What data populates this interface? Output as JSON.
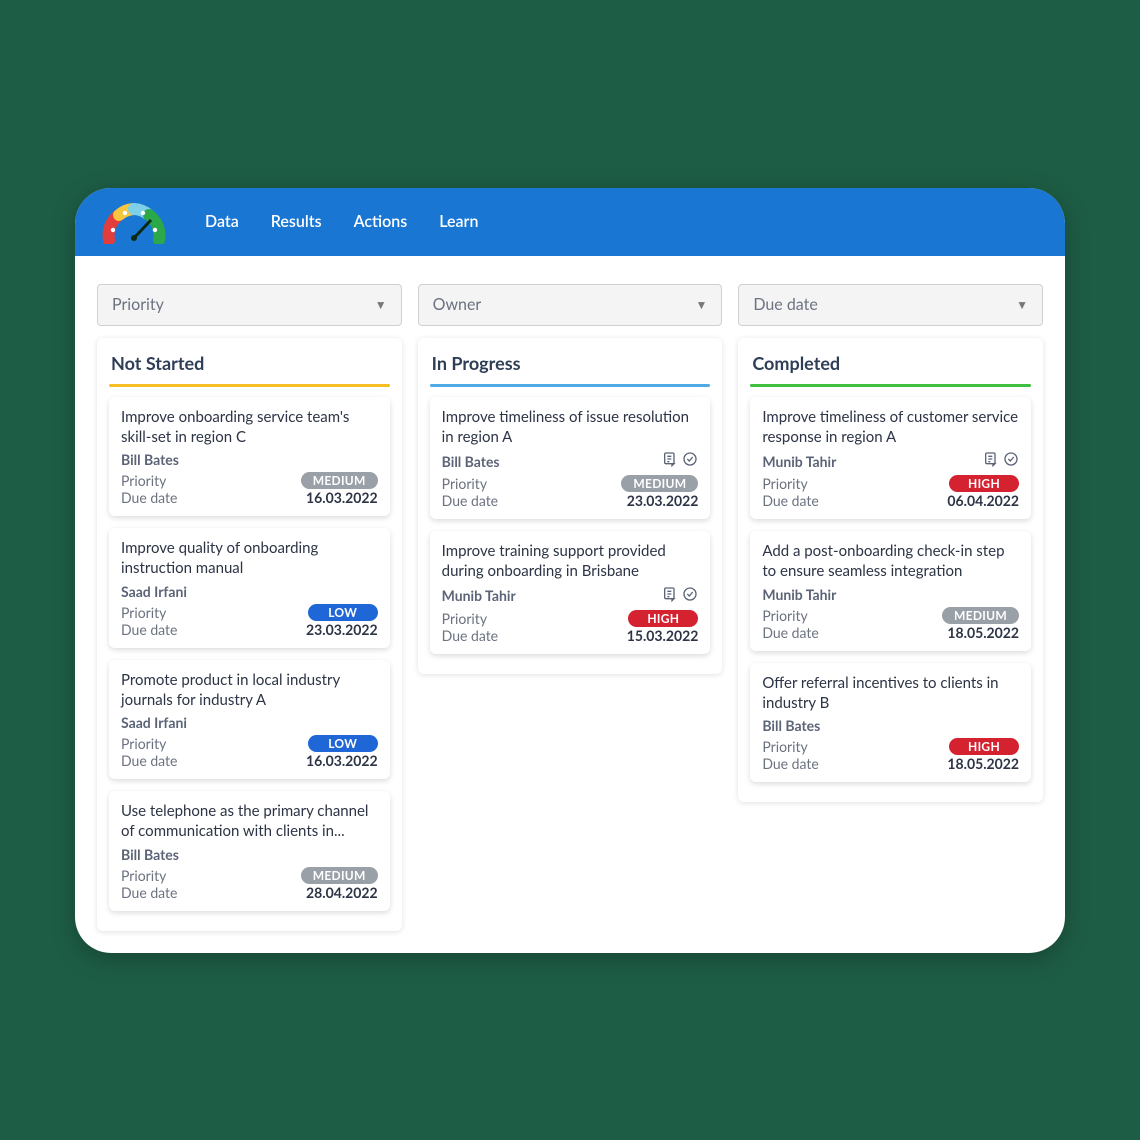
{
  "nav": {
    "items": [
      "Data",
      "Results",
      "Actions",
      "Learn"
    ]
  },
  "filters": [
    {
      "label": "Priority"
    },
    {
      "label": "Owner"
    },
    {
      "label": "Due date"
    }
  ],
  "labels": {
    "priority": "Priority",
    "due": "Due date"
  },
  "priority_values": {
    "medium": "MEDIUM",
    "low": "LOW",
    "high": "HIGH"
  },
  "columns": [
    {
      "title": "Not Started",
      "ruleClass": "rule-ns",
      "cards": [
        {
          "title": "Improve onboarding service team's skill-set in region C",
          "owner": "Bill Bates",
          "priority": "medium",
          "due": "16.03.2022",
          "icons": false
        },
        {
          "title": "Improve quality of onboarding instruction manual",
          "owner": "Saad Irfani",
          "priority": "low",
          "due": "23.03.2022",
          "icons": false
        },
        {
          "title": "Promote product in local industry journals for industry A",
          "owner": "Saad Irfani",
          "priority": "low",
          "due": "16.03.2022",
          "icons": false
        },
        {
          "title": "Use telephone as the primary channel of communication with clients in...",
          "owner": "Bill Bates",
          "priority": "medium",
          "due": "28.04.2022",
          "icons": false
        }
      ]
    },
    {
      "title": "In Progress",
      "ruleClass": "rule-ip",
      "cards": [
        {
          "title": "Improve timeliness of issue resolution in region A",
          "owner": "Bill Bates",
          "priority": "medium",
          "due": "23.03.2022",
          "icons": true
        },
        {
          "title": "Improve training support provided during onboarding in Brisbane",
          "owner": "Munib Tahir",
          "priority": "high",
          "due": "15.03.2022",
          "icons": true
        }
      ]
    },
    {
      "title": "Completed",
      "ruleClass": "rule-cp",
      "cards": [
        {
          "title": "Improve timeliness of customer service response in region A",
          "owner": "Munib Tahir",
          "priority": "high",
          "due": "06.04.2022",
          "icons": true
        },
        {
          "title": "Add a post-onboarding check-in step to ensure seamless integration",
          "owner": "Munib Tahir",
          "priority": "medium",
          "due": "18.05.2022",
          "icons": false
        },
        {
          "title": "Offer referral incentives to clients in industry B",
          "owner": "Bill Bates",
          "priority": "high",
          "due": "18.05.2022",
          "icons": false
        }
      ]
    }
  ]
}
